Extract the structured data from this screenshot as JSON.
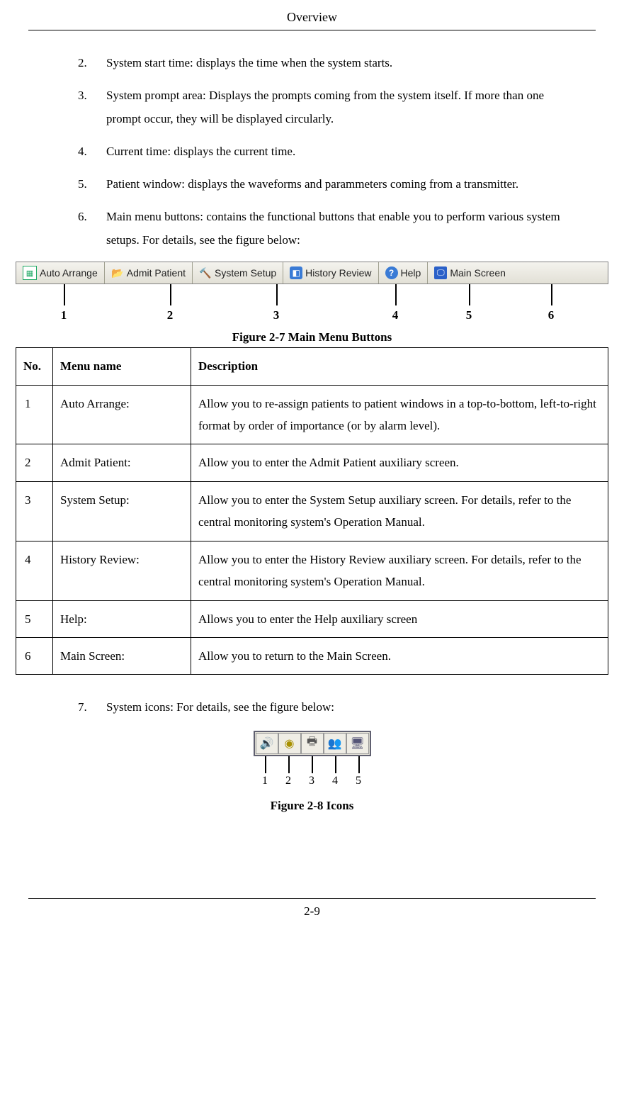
{
  "header": {
    "title": "Overview"
  },
  "list_pre": [
    {
      "n": "2.",
      "t": "System start time: displays the time when the system starts."
    },
    {
      "n": "3.",
      "t": "System prompt area: Displays the prompts coming from the system itself. If more than one prompt occur, they will be displayed circularly."
    },
    {
      "n": "4.",
      "t": "Current time: displays the current time."
    },
    {
      "n": "5.",
      "t": "Patient window: displays the waveforms and parammeters coming from a transmitter."
    },
    {
      "n": "6.",
      "t": "Main menu buttons: contains the functional buttons that enable you to perform various system setups. For details, see the figure below:"
    }
  ],
  "toolbar": {
    "buttons": [
      {
        "label": "Auto Arrange"
      },
      {
        "label": "Admit Patient"
      },
      {
        "label": "System Setup"
      },
      {
        "label": "History Review"
      },
      {
        "label": "Help"
      },
      {
        "label": "Main Screen"
      }
    ]
  },
  "toolbar_markers": [
    "1",
    "2",
    "3",
    "4",
    "5",
    "6"
  ],
  "fig27_caption": "Figure 2-7 Main Menu Buttons",
  "table": {
    "headers": {
      "no": "No.",
      "name": "Menu name",
      "desc": "Description"
    },
    "rows": [
      {
        "no": "1",
        "name": " Auto Arrange:",
        "desc": "Allow you to re-assign patients to patient windows in a top-to-bottom, left-to-right format by order of importance (or by alarm level)."
      },
      {
        "no": "2",
        "name": "Admit Patient:",
        "desc": "Allow you to enter the Admit Patient auxiliary screen."
      },
      {
        "no": "3",
        "name": "System Setup:",
        "desc": "Allow you to enter the System Setup auxiliary screen. For details, refer to the central monitoring system's Operation Manual."
      },
      {
        "no": "4",
        "name": "History Review:",
        "desc": "Allow you to enter the History Review auxiliary screen. For details, refer to the central monitoring system's Operation Manual."
      },
      {
        "no": "5",
        "name": "Help:",
        "desc": "Allows you to enter the Help auxiliary screen"
      },
      {
        "no": "6",
        "name": "Main Screen:",
        "desc": "Allow you to return to the Main Screen."
      }
    ]
  },
  "list_post": [
    {
      "n": "7.",
      "t": "System icons: For details, see the figure below:"
    }
  ],
  "icons_markers": [
    "1",
    "2",
    "3",
    "4",
    "5"
  ],
  "fig28_caption": "Figure 2-8 Icons",
  "page_number": "2-9"
}
